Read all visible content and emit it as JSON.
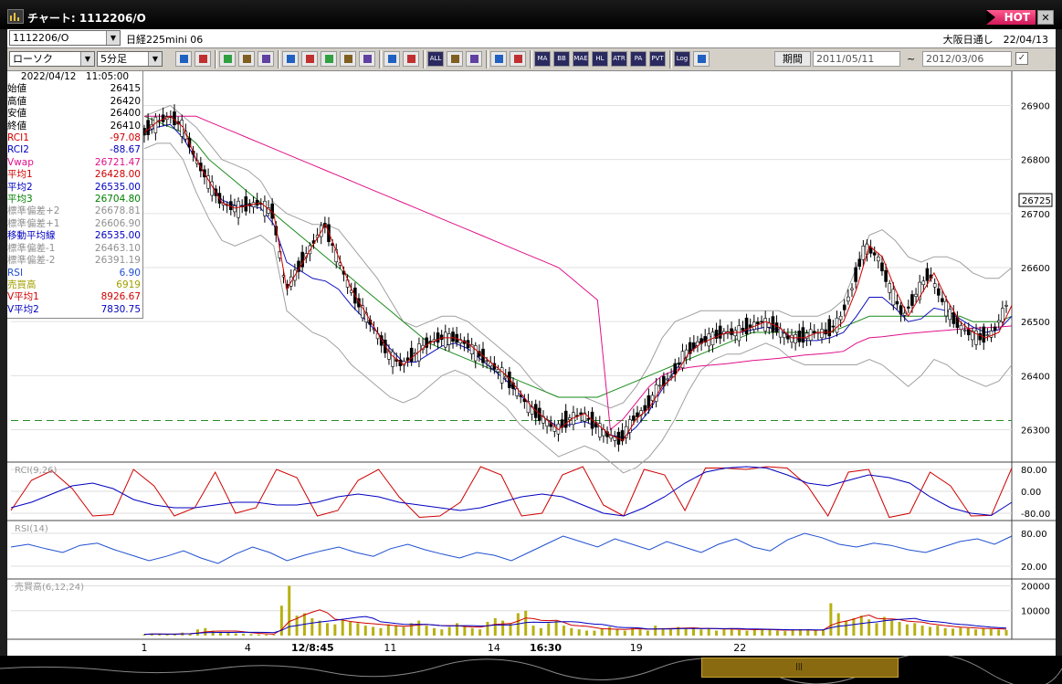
{
  "window": {
    "title": "チャート: 1112206/O",
    "hot_label": "HOT",
    "close_label": "✕"
  },
  "header": {
    "symbol_value": "1112206/O",
    "instrument_name": "日経225mini 06",
    "market_info": "大阪日通し　22/04/13"
  },
  "toolbar": {
    "chart_type": "ローソク",
    "interval": "5分足",
    "icons": [
      "zoom-icon",
      "crosshair-icon",
      "pin-icon",
      "search-chart-icon",
      "bar-chart-icon",
      "compare-icon",
      "cursor-icon",
      "pencil-icon",
      "arrow-icon",
      "rotate-icon",
      "candle-icon",
      "candle-split-icon",
      "all-icon",
      "settings-icon",
      "paint-icon",
      "palette-icon",
      "grid-icon",
      "ma-icon",
      "bb-icon",
      "mae-icon",
      "hl-icon",
      "atr-icon",
      "para-icon",
      "pvt-icon",
      "log-icon",
      "export-icon"
    ],
    "icon_labels": {
      "all": "ALL",
      "ma": "MA",
      "bb": "BB",
      "mae": "MAE",
      "hl": "HL",
      "atr": "ATR",
      "para": "PA RA",
      "pvt": "PVT",
      "log": "Log"
    },
    "period_label": "期間",
    "date_from": "2011/05/11",
    "date_to": "2012/03/06",
    "tilde": "~"
  },
  "info_panel": {
    "timestamp": "2022/04/12　11:05:00",
    "rows": [
      {
        "label": "始値",
        "value": "26415",
        "color": "#000000"
      },
      {
        "label": "高値",
        "value": "26420",
        "color": "#000000"
      },
      {
        "label": "安値",
        "value": "26400",
        "color": "#000000"
      },
      {
        "label": "終値",
        "value": "26410",
        "color": "#000000"
      },
      {
        "label": "RCI1",
        "value": "-97.08",
        "color": "#d00000"
      },
      {
        "label": "RCI2",
        "value": "-88.67",
        "color": "#0000c0"
      },
      {
        "label": "Vwap",
        "value": "26721.47",
        "color": "#e0108a"
      },
      {
        "label": "平均1",
        "value": "26428.00",
        "color": "#d00000"
      },
      {
        "label": "平均2",
        "value": "26535.00",
        "color": "#0000c0"
      },
      {
        "label": "平均3",
        "value": "26704.80",
        "color": "#008000"
      },
      {
        "label": "標準偏差+2",
        "value": "26678.81",
        "color": "#909090"
      },
      {
        "label": "標準偏差+1",
        "value": "26606.90",
        "color": "#909090"
      },
      {
        "label": "移動平均線",
        "value": "26535.00",
        "color": "#0000c0"
      },
      {
        "label": "標準偏差-1",
        "value": "26463.10",
        "color": "#909090"
      },
      {
        "label": "標準偏差-2",
        "value": "26391.19",
        "color": "#909090"
      },
      {
        "label": "RSI",
        "value": "6.90",
        "color": "#2050d0"
      },
      {
        "label": "売買高",
        "value": "6919",
        "color": "#a0a000"
      },
      {
        "label": "V平均1",
        "value": "8926.67",
        "color": "#d00000"
      },
      {
        "label": "V平均2",
        "value": "7830.75",
        "color": "#0000c0"
      }
    ]
  },
  "chart_data": [
    {
      "type": "candlestick",
      "price_ticks": [
        "26900",
        "26800",
        "26700",
        "26600",
        "26500",
        "26400",
        "26300"
      ],
      "ylim": [
        26240,
        26960
      ],
      "current_price": "26725",
      "dashed_level": 26317,
      "close": [
        26850,
        26870,
        26880,
        26860,
        26800,
        26760,
        26720,
        26710,
        26715,
        26720,
        26700,
        26560,
        26600,
        26640,
        26680,
        26620,
        26560,
        26520,
        26480,
        26440,
        26420,
        26440,
        26460,
        26470,
        26470,
        26460,
        26440,
        26420,
        26400,
        26370,
        26340,
        26320,
        26300,
        26320,
        26330,
        26310,
        26290,
        26280,
        26320,
        26340,
        26380,
        26400,
        26440,
        26460,
        26470,
        26480,
        26480,
        26490,
        26500,
        26490,
        26470,
        26470,
        26480,
        26480,
        26500,
        26560,
        26640,
        26620,
        26560,
        26510,
        26550,
        26590,
        26540,
        26500,
        26480,
        26470,
        26480,
        26530
      ],
      "bb_upper": [
        26880,
        26890,
        26900,
        26880,
        26860,
        26830,
        26800,
        26790,
        26780,
        26760,
        26720,
        26700,
        26690,
        26680,
        26680,
        26670,
        26640,
        26610,
        26580,
        26540,
        26500,
        26490,
        26500,
        26510,
        26510,
        26500,
        26480,
        26460,
        26440,
        26420,
        26390,
        26370,
        26360,
        26360,
        26360,
        26350,
        26340,
        26350,
        26380,
        26420,
        26470,
        26500,
        26510,
        26520,
        26520,
        26520,
        26520,
        26520,
        26520,
        26520,
        26510,
        26510,
        26510,
        26520,
        26540,
        26600,
        26660,
        26670,
        26650,
        26620,
        26610,
        26620,
        26620,
        26610,
        26590,
        26580,
        26580,
        26600
      ],
      "bb_lower": [
        26820,
        26830,
        26830,
        26800,
        26740,
        26690,
        26650,
        26640,
        26650,
        26660,
        26640,
        26520,
        26500,
        26480,
        26470,
        26450,
        26420,
        26400,
        26380,
        26360,
        26350,
        26360,
        26380,
        26400,
        26410,
        26400,
        26380,
        26360,
        26340,
        26310,
        26290,
        26270,
        26250,
        26260,
        26270,
        26260,
        26240,
        26220,
        26230,
        26250,
        26280,
        26320,
        26370,
        26410,
        26430,
        26440,
        26440,
        26450,
        26460,
        26450,
        26430,
        26420,
        26420,
        26420,
        26420,
        26420,
        26430,
        26420,
        26400,
        26380,
        26400,
        26430,
        26420,
        26400,
        26390,
        26380,
        26390,
        26420
      ],
      "ma_slow": [
        26880,
        26870,
        26860,
        26850,
        26830,
        26800,
        26780,
        26760,
        26740,
        26720,
        26700,
        26680,
        26660,
        26640,
        26620,
        26600,
        26580,
        26560,
        26540,
        26520,
        26500,
        26480,
        26460,
        26450,
        26440,
        26430,
        26420,
        26410,
        26400,
        26390,
        26380,
        26370,
        26360,
        26360,
        26360,
        26360,
        26370,
        26380,
        26390,
        26400,
        26410,
        26420,
        26430,
        26440,
        26450,
        26460,
        26470,
        26480,
        26480,
        26480,
        26480,
        26480,
        26480,
        26480,
        26490,
        26500,
        26510,
        26510,
        26510,
        26510,
        26510,
        26510,
        26510,
        26510,
        26500,
        26500,
        26500,
        26510
      ],
      "vwap": [
        26880,
        26880,
        26880,
        26880,
        26880,
        26870,
        26860,
        26850,
        26840,
        26830,
        26820,
        26810,
        26800,
        26790,
        26780,
        26770,
        26760,
        26750,
        26740,
        26730,
        26720,
        26710,
        26700,
        26690,
        26680,
        26670,
        26660,
        26650,
        26640,
        26630,
        26620,
        26610,
        26600,
        26580,
        26560,
        26540,
        26300,
        26320,
        26350,
        26380,
        26400,
        26410,
        26415,
        26418,
        26420,
        26422,
        26425,
        26428,
        26430,
        26432,
        26435,
        26438,
        26440,
        26442,
        26445,
        26460,
        26470,
        26472,
        26475,
        26478,
        26480,
        26482,
        26484,
        26486,
        26488,
        26489,
        26490,
        26492
      ],
      "x_labels": [
        {
          "label": "1",
          "i": 0,
          "bold": false
        },
        {
          "label": "4",
          "i": 8,
          "bold": false
        },
        {
          "label": "12/8:45",
          "i": 13,
          "bold": true
        },
        {
          "label": "11",
          "i": 19,
          "bold": false
        },
        {
          "label": "14",
          "i": 27,
          "bold": false
        },
        {
          "label": "16:30",
          "i": 31,
          "bold": true
        },
        {
          "label": "19",
          "i": 38,
          "bold": false
        },
        {
          "label": "22",
          "i": 46,
          "bold": false
        }
      ]
    },
    {
      "type": "line",
      "title": "RCI(9,26)",
      "y_ticks": [
        "80.00",
        "0.00",
        "-80.00"
      ],
      "ylim": [
        -100,
        100
      ],
      "series": [
        {
          "name": "RCI1",
          "color": "#d00000",
          "values": [
            -70,
            40,
            75,
            10,
            -90,
            -85,
            80,
            20,
            -90,
            -60,
            70,
            -80,
            -60,
            80,
            50,
            -90,
            -70,
            40,
            80,
            -20,
            -95,
            -90,
            -40,
            90,
            60,
            -90,
            -80,
            60,
            90,
            -50,
            -90,
            80,
            60,
            -70,
            85,
            85,
            80,
            90,
            85,
            20,
            -90,
            70,
            80,
            -95,
            -80,
            70,
            20,
            -90,
            -88,
            85
          ]
        },
        {
          "name": "RCI2",
          "color": "#0000c0",
          "values": [
            -60,
            -40,
            -10,
            20,
            30,
            10,
            -30,
            -50,
            -60,
            -60,
            -50,
            -40,
            -40,
            -50,
            -50,
            -40,
            -20,
            -10,
            -20,
            -40,
            -50,
            -60,
            -70,
            -60,
            -40,
            -20,
            -10,
            -20,
            -50,
            -80,
            -90,
            -60,
            -20,
            30,
            70,
            85,
            90,
            85,
            60,
            30,
            20,
            40,
            60,
            50,
            30,
            -20,
            -60,
            -80,
            -88,
            -40
          ]
        }
      ]
    },
    {
      "type": "line",
      "title": "RSI(14)",
      "y_ticks": [
        "80.00",
        "20.00"
      ],
      "ylim": [
        0,
        100
      ],
      "series": [
        {
          "name": "RSI",
          "color": "#2050d0",
          "values": [
            55,
            60,
            52,
            45,
            58,
            62,
            50,
            40,
            30,
            38,
            48,
            35,
            25,
            42,
            55,
            45,
            30,
            40,
            48,
            55,
            45,
            38,
            52,
            60,
            50,
            42,
            35,
            45,
            40,
            30,
            45,
            60,
            75,
            65,
            55,
            70,
            60,
            50,
            65,
            55,
            45,
            60,
            70,
            55,
            48,
            68,
            80,
            72,
            60,
            55,
            62,
            58,
            50,
            45,
            55,
            65,
            70,
            60,
            75
          ]
        }
      ]
    },
    {
      "type": "bar",
      "title": "売買高(6,12,24)",
      "y_ticks": [
        "20000",
        "10000"
      ],
      "ylim": [
        0,
        22000
      ],
      "values": [
        500,
        800,
        600,
        400,
        700,
        1200,
        900,
        2500,
        3000,
        2000,
        1500,
        1200,
        900,
        800,
        600,
        500,
        400,
        300,
        12000,
        20000,
        8000,
        9000,
        7000,
        6000,
        5000,
        4500,
        6000,
        5500,
        5000,
        4000,
        3500,
        3000,
        4500,
        4000,
        3500,
        5000,
        6000,
        4000,
        3000,
        2500,
        3500,
        5000,
        4000,
        3000,
        2500,
        5500,
        7000,
        6000,
        5000,
        9000,
        10000,
        4000,
        3000,
        5000,
        6000,
        4000,
        3000,
        2500,
        2000,
        2000,
        3000,
        3500,
        2500,
        2000,
        3000,
        2500,
        2000,
        4000,
        3000,
        2500,
        3500,
        3000,
        2800,
        2500,
        3000,
        2000,
        2500,
        3000,
        2200,
        2000,
        2500,
        2400,
        2600,
        2000,
        1800,
        2200,
        2600,
        2400,
        2000,
        2500,
        13000,
        9000,
        6000,
        7000,
        8000,
        6500,
        5000,
        7500,
        6000,
        5500,
        4500,
        5000,
        4000,
        3500,
        4000,
        3000,
        2800,
        3200,
        3000,
        2500,
        2800,
        2600,
        2400,
        2200
      ]
    }
  ],
  "colors": {
    "up_candle": "#ffffff",
    "down_candle": "#000000",
    "accent_hot": "#e01868",
    "vol_bar": "#b8b010"
  }
}
